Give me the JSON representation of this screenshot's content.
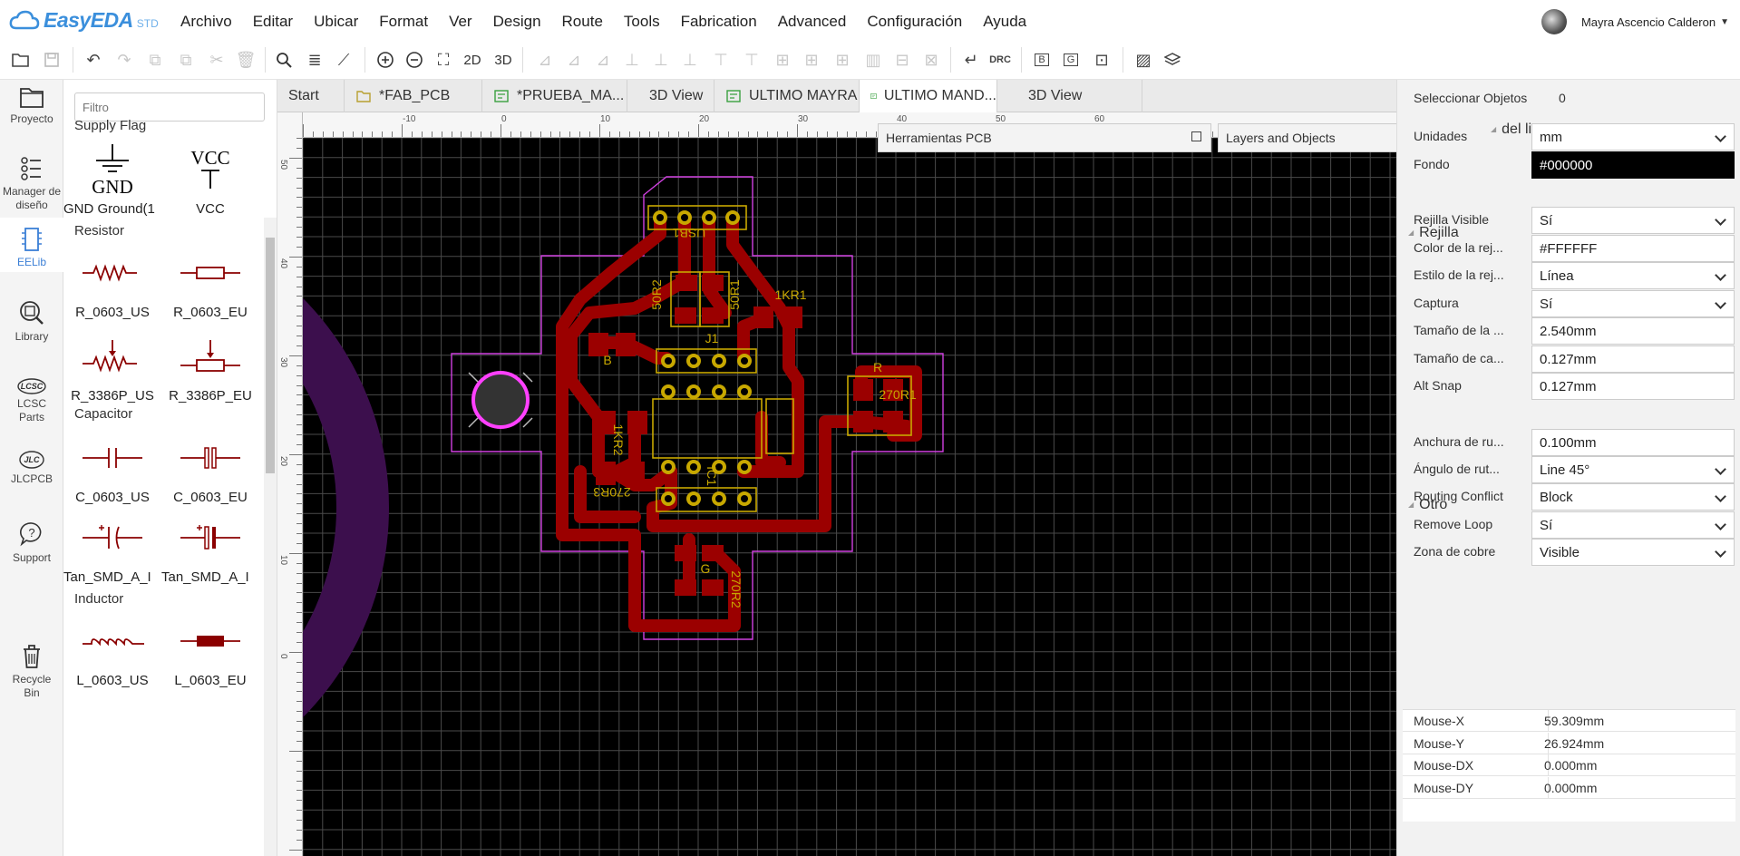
{
  "app": {
    "brand": "EasyEDA",
    "edition": "STD",
    "menus": [
      "Archivo",
      "Editar",
      "Ubicar",
      "Format",
      "Ver",
      "Design",
      "Route",
      "Tools",
      "Fabrication",
      "Advanced",
      "Configuración",
      "Ayuda"
    ],
    "user": "Mayra Ascencio Calderon"
  },
  "toolbar": {
    "view2d": "2D",
    "view3d": "3D",
    "drc": "DRC",
    "btn_b": "B",
    "btn_g": "G"
  },
  "iconbar": [
    {
      "label": "Proyecto",
      "icon": "folder-icon"
    },
    {
      "label": "Manager de diseño",
      "icon": "list-icon"
    },
    {
      "label": "EELib",
      "icon": "chip-icon"
    },
    {
      "label": "Library",
      "icon": "library-search-icon"
    },
    {
      "label": "LCSC Parts",
      "icon": "lcsc-icon"
    },
    {
      "label": "JLCPCB",
      "icon": "jlc-icon"
    },
    {
      "label": "Support",
      "icon": "support-icon"
    },
    {
      "label": "Recycle Bin",
      "icon": "trash-icon"
    }
  ],
  "library": {
    "filter_placeholder": "Filtro",
    "sections": [
      {
        "title": "Supply Flag",
        "items": [
          "GND Ground(1",
          "VCC"
        ]
      },
      {
        "title": "Resistor",
        "items": [
          "R_0603_US",
          "R_0603_EU",
          "R_3386P_US",
          "R_3386P_EU"
        ]
      },
      {
        "title": "Capacitor",
        "items": [
          "C_0603_US",
          "C_0603_EU",
          "Tan_SMD_A_I",
          "Tan_SMD_A_I"
        ]
      },
      {
        "title": "Inductor",
        "items": [
          "L_0603_US",
          "L_0603_EU"
        ]
      }
    ],
    "symbol_text": {
      "gnd": "GND",
      "vcc": "VCC"
    }
  },
  "tabs": [
    "Start",
    "*FAB_PCB",
    "*PRUEBA_MA...",
    "3D View",
    "ULTIMO MAYRA",
    "ULTIMO MAND...",
    "3D View"
  ],
  "active_tab": 5,
  "rulers": {
    "h": [
      "-10",
      "0",
      "10",
      "20",
      "30",
      "40",
      "50",
      "60"
    ],
    "v": [
      "50",
      "40",
      "30",
      "20",
      "10",
      "0"
    ]
  },
  "panels": {
    "pcb_tools": "Herramientas PCB",
    "layers": "Layers and Objects"
  },
  "pcb_labels": [
    "USB1",
    "50R2",
    "50R1",
    "1KR1",
    "J1",
    "B",
    "R",
    "270R1",
    "1KR2",
    "270R3",
    "IC1",
    "G",
    "270R2"
  ],
  "right": {
    "select_label": "Seleccionar Objetos",
    "select_count": "0",
    "canvas_title": "del lienzo",
    "canvas_props": [
      {
        "label": "Unidades",
        "value": "mm",
        "select": true
      },
      {
        "label": "Fondo",
        "value": "#000000",
        "select": false,
        "dark": true
      }
    ],
    "grid_title": "Rejilla",
    "grid_props": [
      {
        "label": "Rejilla Visible",
        "value": "Sí",
        "select": true
      },
      {
        "label": "Color de la rej...",
        "value": "#FFFFFF",
        "select": false
      },
      {
        "label": "Estilo de la rej...",
        "value": "Línea",
        "select": true
      },
      {
        "label": "Captura",
        "value": "Sí",
        "select": true
      },
      {
        "label": "Tamaño de la ...",
        "value": "2.540mm",
        "select": false
      },
      {
        "label": "Tamaño de ca...",
        "value": "0.127mm",
        "select": false
      },
      {
        "label": "Alt Snap",
        "value": "0.127mm",
        "select": false
      }
    ],
    "other_title": "Otro",
    "other_props": [
      {
        "label": "Anchura de ru...",
        "value": "0.100mm",
        "select": false
      },
      {
        "label": "Ángulo de rut...",
        "value": "Line 45°",
        "select": true
      },
      {
        "label": "Routing Conflict",
        "value": "Block",
        "select": true
      },
      {
        "label": "Remove Loop",
        "value": "Sí",
        "select": true
      },
      {
        "label": "Zona de cobre",
        "value": "Visible",
        "select": true
      }
    ],
    "mouse": [
      {
        "label": "Mouse-X",
        "value": "59.309mm"
      },
      {
        "label": "Mouse-Y",
        "value": "26.924mm"
      },
      {
        "label": "Mouse-DX",
        "value": "0.000mm"
      },
      {
        "label": "Mouse-DY",
        "value": "0.000mm"
      }
    ]
  },
  "colors": {
    "accent": "#3b8fdc",
    "trace": "#9b0000",
    "silkscreen": "#c8a800",
    "outline": "#d040e0",
    "grid": "#ffffff",
    "background": "#000000"
  }
}
